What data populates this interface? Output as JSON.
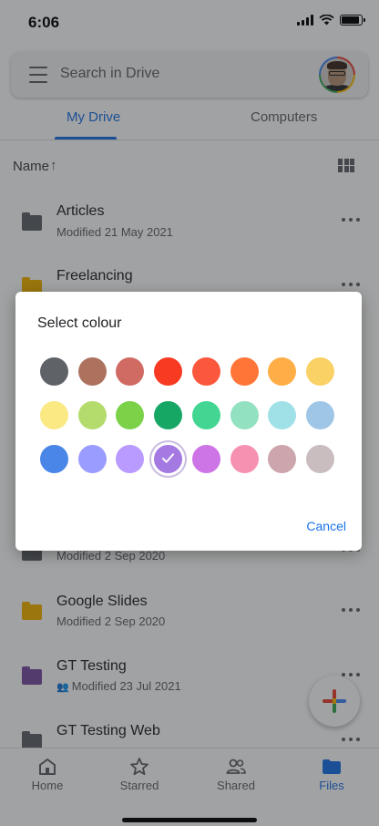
{
  "status_bar": {
    "time": "6:06"
  },
  "search": {
    "placeholder": "Search in Drive"
  },
  "tabs": [
    {
      "label": "My Drive",
      "active": true
    },
    {
      "label": "Computers",
      "active": false
    }
  ],
  "sort": {
    "label": "Name",
    "arrow": "↑"
  },
  "files": [
    {
      "name": "Articles",
      "meta": "Modified 21 May 2021",
      "folder_color": "#5f6368",
      "shared": false
    },
    {
      "name": "Freelancing",
      "meta": "",
      "folder_color": "#f4b400",
      "shared": false
    },
    {
      "name": "",
      "meta": "Modified 2 Sep 2020",
      "folder_color": "#5f6368",
      "shared": false
    },
    {
      "name": "Google Slides",
      "meta": "Modified 2 Sep 2020",
      "folder_color": "#f4b400",
      "shared": false
    },
    {
      "name": "GT Testing",
      "meta": "Modified 23 Jul 2021",
      "folder_color": "#7b4ea3",
      "shared": true
    },
    {
      "name": "GT Testing Web",
      "meta": "",
      "folder_color": "#5f6368",
      "shared": false
    }
  ],
  "dialog": {
    "title": "Select colour",
    "cancel_label": "Cancel",
    "swatches": [
      "#5f6368",
      "#ac725e",
      "#d06b64",
      "#f83a22",
      "#fa573c",
      "#ff7537",
      "#ffad46",
      "#fad165",
      "#fbe983",
      "#b3dc6c",
      "#7bd148",
      "#16a765",
      "#42d692",
      "#92e1c0",
      "#9fe1e7",
      "#9fc6e7",
      "#4986e7",
      "#9a9cff",
      "#b99aff",
      "#a47ae2",
      "#cd74e6",
      "#f691b2",
      "#cca6ac",
      "#cabdbf"
    ],
    "selected_swatch": 19
  },
  "bottom_nav": [
    {
      "label": "Home",
      "icon": "home-icon",
      "active": false
    },
    {
      "label": "Starred",
      "icon": "star-icon",
      "active": false
    },
    {
      "label": "Shared",
      "icon": "people-icon",
      "active": false
    },
    {
      "label": "Files",
      "icon": "folder-icon",
      "active": true
    }
  ],
  "colors": {
    "accent": "#1a73e8"
  }
}
